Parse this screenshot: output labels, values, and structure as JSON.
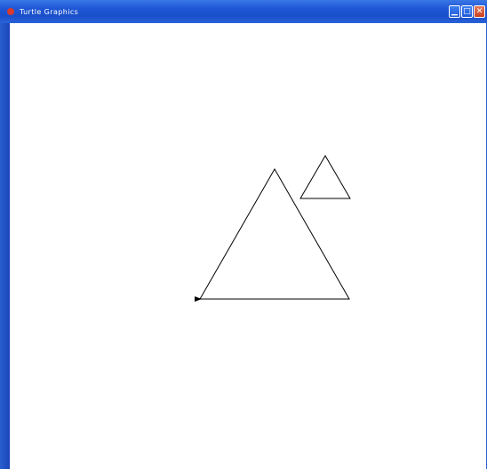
{
  "window": {
    "title": "Turtle Graphics",
    "controls": {
      "minimize": "▁",
      "maximize": "□",
      "close": "✕"
    }
  },
  "canvas": {
    "background": "#ffffff",
    "stroke_color": "#000000",
    "shapes": [
      "large-triangle",
      "small-triangle"
    ],
    "turtle": "arrow-cursor"
  }
}
